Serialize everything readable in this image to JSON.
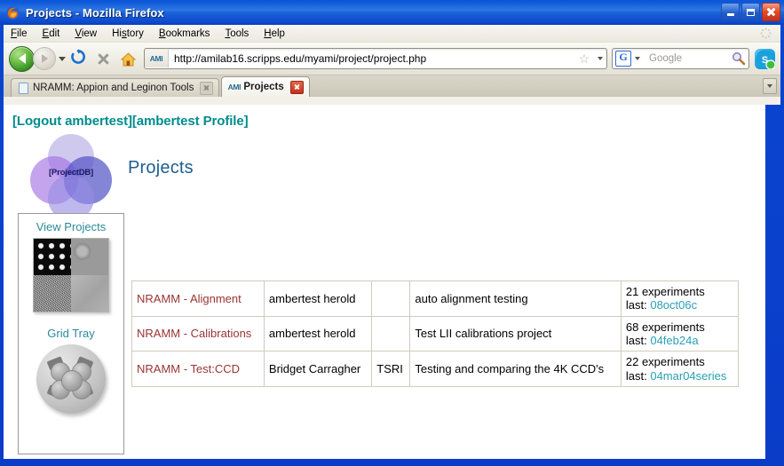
{
  "window": {
    "title": "Projects - Mozilla Firefox",
    "app_icon": "firefox-icon",
    "minimize_label": "Minimize",
    "maximize_label": "Maximize",
    "close_label": "Close"
  },
  "menubar": {
    "items": [
      {
        "label": "File",
        "accel": "F"
      },
      {
        "label": "Edit",
        "accel": "E"
      },
      {
        "label": "View",
        "accel": "V"
      },
      {
        "label": "History",
        "accel": "s"
      },
      {
        "label": "Bookmarks",
        "accel": "B"
      },
      {
        "label": "Tools",
        "accel": "T"
      },
      {
        "label": "Help",
        "accel": "H"
      }
    ]
  },
  "toolbar": {
    "back_label": "Back",
    "forward_label": "Forward",
    "history_dropdown_label": "Recent pages",
    "reload_label": "Reload",
    "stop_label": "Stop",
    "home_label": "Home",
    "url_favicon": "ami-favicon",
    "url_value": "http://amilab16.scripps.edu/myami/project/project.php",
    "url_placeholder": "Go to a Website",
    "bookmark_star_label": "Bookmark this page",
    "url_dropdown_label": "Show history",
    "search_engine": "G",
    "search_placeholder": "Google",
    "search_value": "",
    "search_go_label": "Search",
    "skype_label": "Skype"
  },
  "tabs": {
    "list_all_label": "List all tabs",
    "items": [
      {
        "label": "NRAMM: Appion and Leginon Tools",
        "active": false,
        "favicon": "page-icon",
        "close_label": "Close Tab"
      },
      {
        "label": "Projects",
        "active": true,
        "favicon": "ami-favicon",
        "close_label": "Close Tab"
      }
    ]
  },
  "page": {
    "account_links": "[Logout ambertest][ambertest Profile]",
    "logout_label": "[Logout ambertest]",
    "profile_label": "[ambertest Profile]",
    "logo_text": "[ProjectDB]",
    "title": "Projects",
    "accent_color": "#008c8c",
    "title_color": "#1f5f8f",
    "project_link_color": "#993333",
    "experiment_link_color": "#2aa0b4"
  },
  "sidebar": {
    "items": [
      {
        "label": "View Projects",
        "thumbnail": "micrograph-grid-thumbnail"
      },
      {
        "label": "Grid Tray",
        "thumbnail": "grid-tray-thumbnail"
      }
    ]
  },
  "projects_table": {
    "rows": [
      {
        "name": "NRAMM - Alignment",
        "owner": "ambertest herold",
        "institution": "",
        "description": "auto alignment testing",
        "experiments_count": "21 experiments",
        "last_prefix": "last: ",
        "last_session": "08oct06c"
      },
      {
        "name": "NRAMM - Calibrations",
        "owner": "ambertest herold",
        "institution": "",
        "description": "Test LII calibrations project",
        "experiments_count": "68 experiments",
        "last_prefix": "last: ",
        "last_session": "04feb24a"
      },
      {
        "name": "NRAMM - Test:CCD",
        "owner": "Bridget Carragher",
        "institution": "TSRI",
        "description": "Testing and comparing the 4K CCD's",
        "experiments_count": "22 experiments",
        "last_prefix": "last: ",
        "last_session": "04mar04series"
      }
    ]
  }
}
